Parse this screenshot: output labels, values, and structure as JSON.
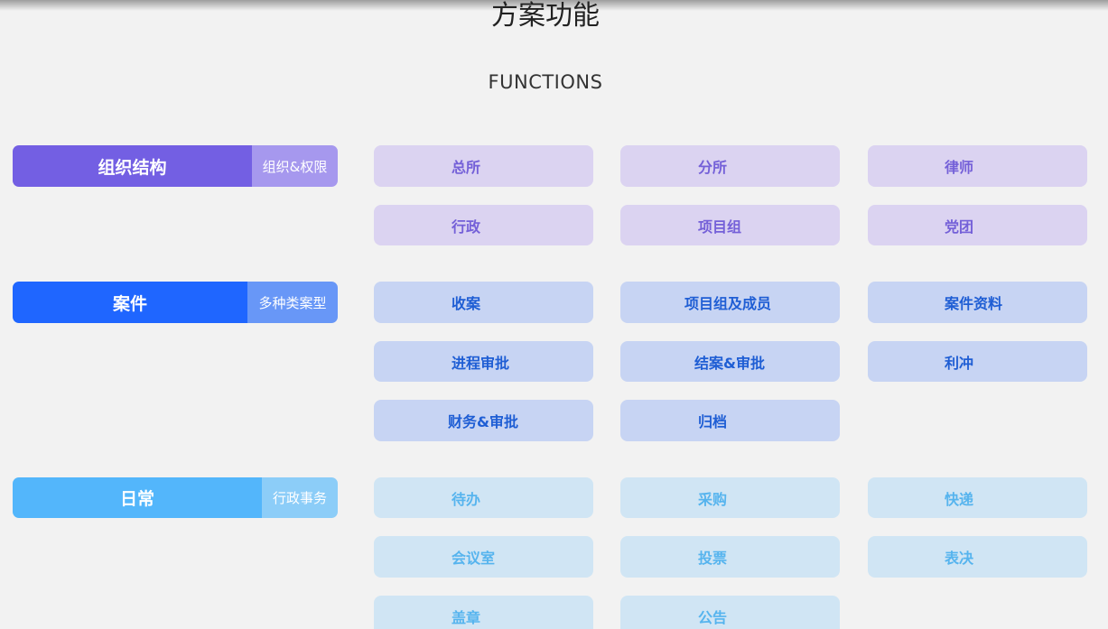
{
  "header": {
    "title": "方案功能",
    "subtitle": "FUNCTIONS"
  },
  "sections": [
    {
      "label": "组织结构",
      "sublabel": "组织&权限",
      "main_color": "#735fe3",
      "sub_color": "#a698ee",
      "items": [
        "总所",
        "分所",
        "律师",
        "行政",
        "项目组",
        "党团"
      ]
    },
    {
      "label": "案件",
      "sublabel": "多种类案型",
      "main_color": "#1f66ff",
      "sub_color": "#6897f7",
      "items": [
        "收案",
        "项目组及成员",
        "案件资料",
        "进程审批",
        "结案&审批",
        "利冲",
        "财务&审批",
        "归档"
      ]
    },
    {
      "label": "日常",
      "sublabel": "行政事务",
      "main_color": "#53b6fb",
      "sub_color": "#8ccdf8",
      "items": [
        "待办",
        "采购",
        "快递",
        "会议室",
        "投票",
        "表决",
        "盖章",
        "公告"
      ]
    }
  ]
}
